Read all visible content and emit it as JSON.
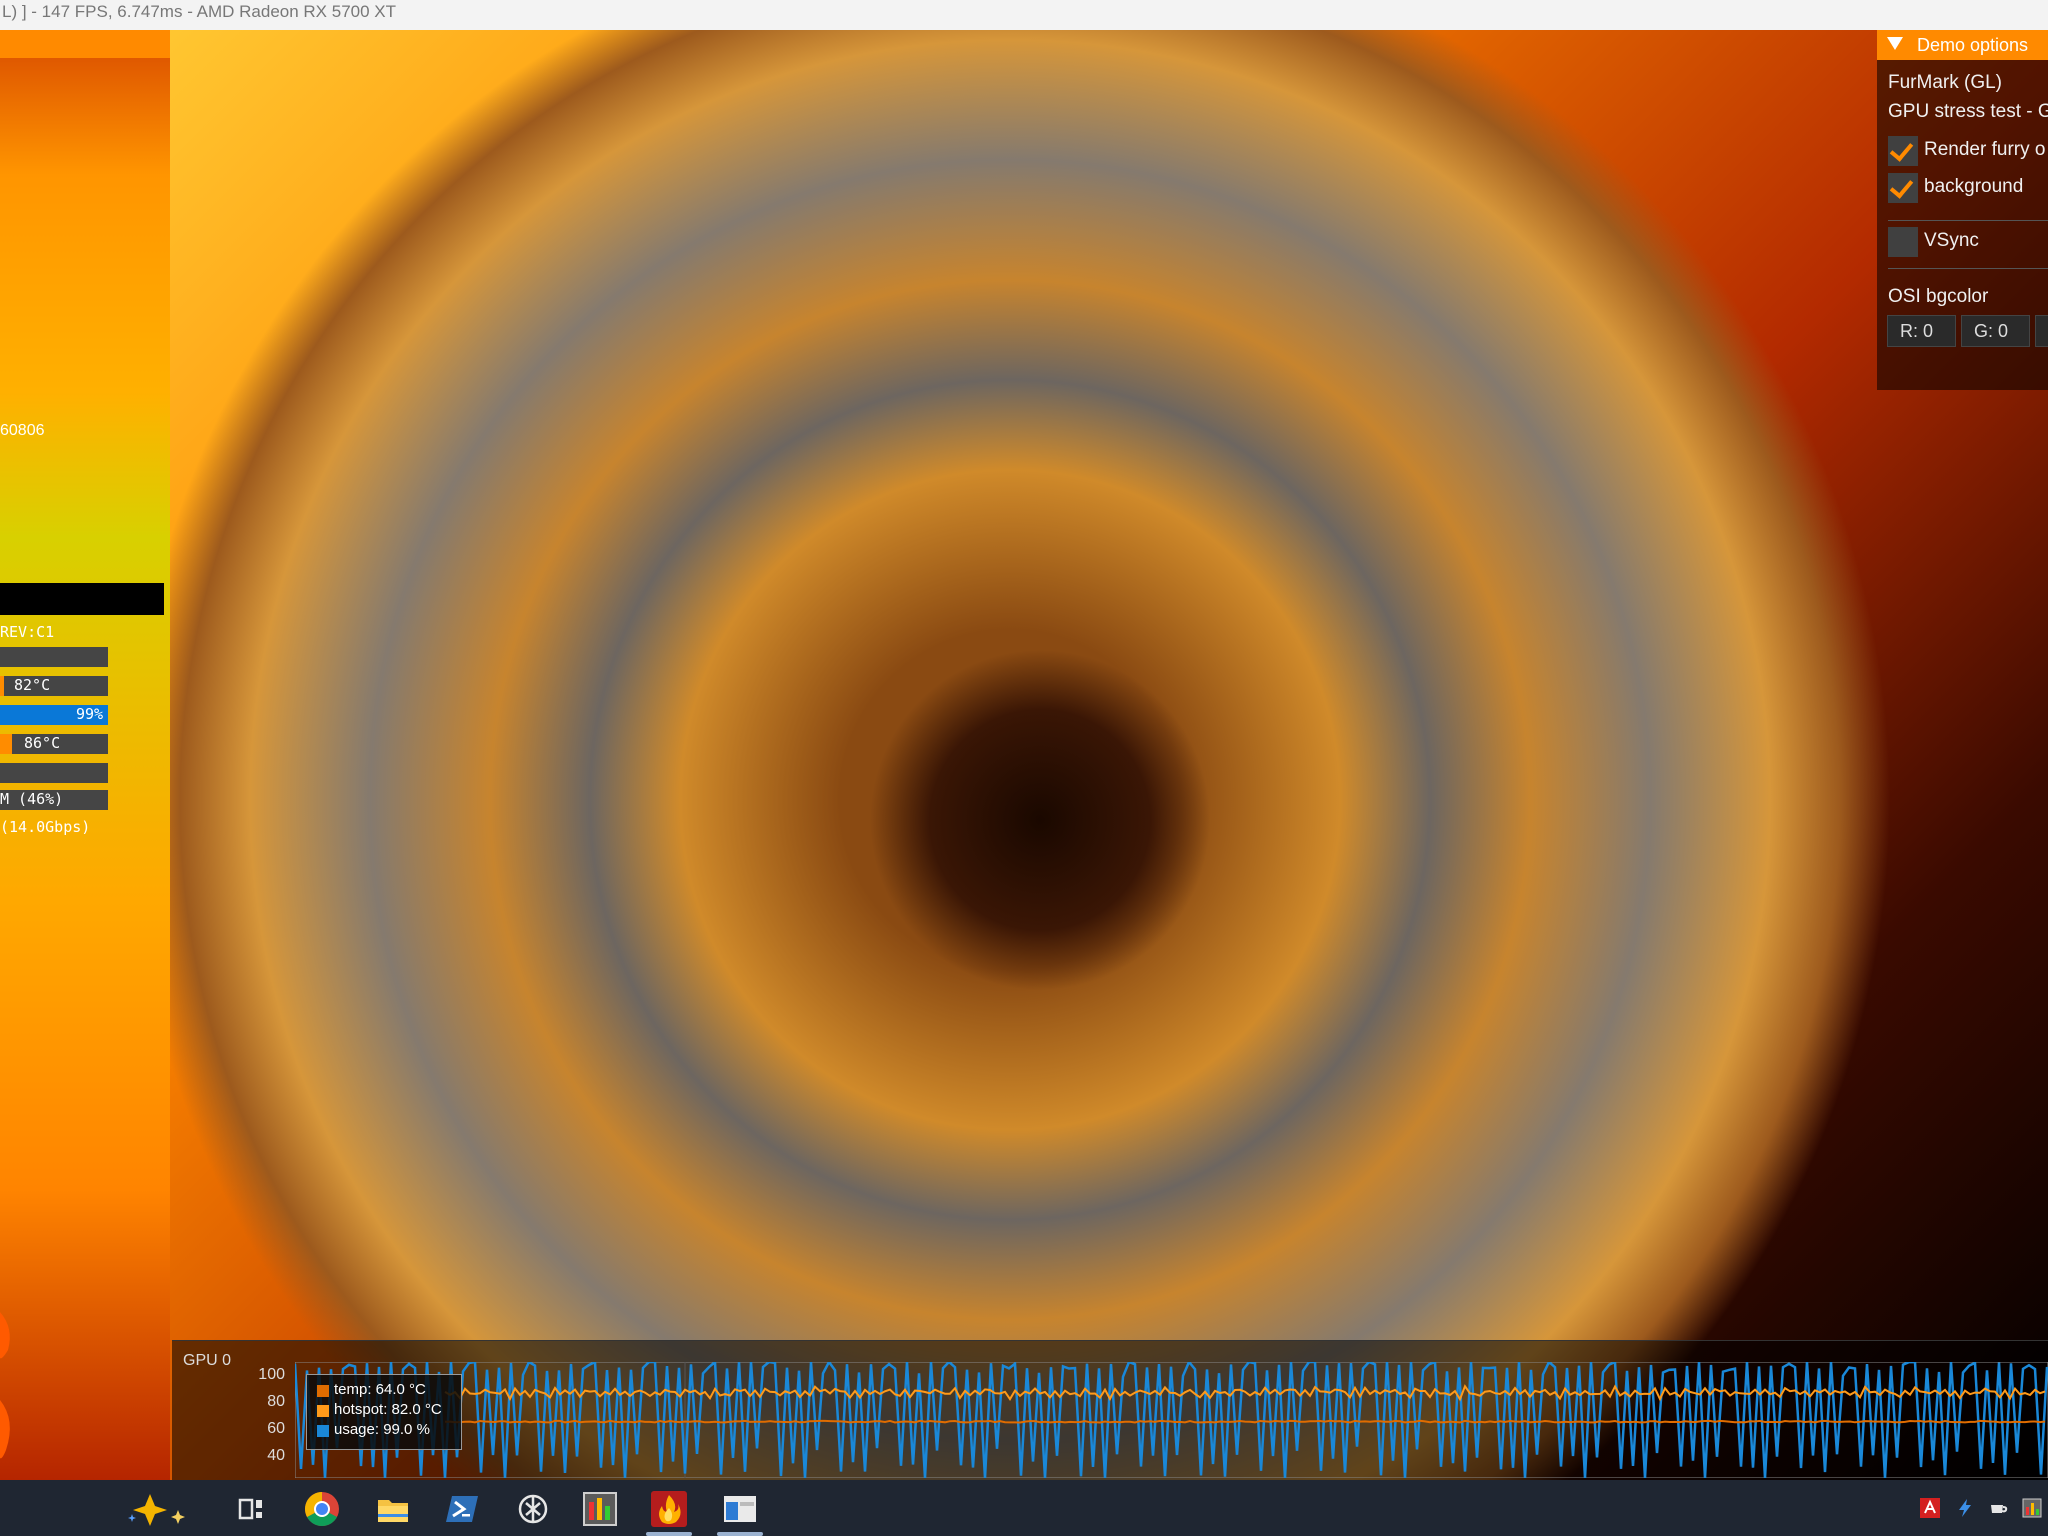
{
  "window": {
    "title": "L) ] - 147 FPS, 6.747ms - AMD Radeon RX 5700 XT"
  },
  "left_panel": {
    "fragment_number": "60806",
    "rev_label": "REV:C1",
    "rows": [
      {
        "label": "82°C",
        "fill_fraction": 0.04,
        "color": "#ff8c00"
      },
      {
        "label": "99%",
        "fill_fraction": 1.0,
        "color": "#0a78d7"
      },
      {
        "label": "86°C",
        "fill_fraction": 0.11,
        "color": "#ff8c00"
      },
      {
        "label": "",
        "fill_fraction": 0.0,
        "color": "#454545"
      },
      {
        "label": "M (46%)",
        "fill_fraction": 0.0,
        "color": "#454545"
      }
    ],
    "memory_speed": "(14.0Gbps)"
  },
  "demo_options": {
    "header": "Demo options",
    "app_name": "FurMark (GL)",
    "mode": "GPU stress test - G",
    "checkbox_render": {
      "label": "Render furry o",
      "checked": true
    },
    "checkbox_background": {
      "label": "background",
      "checked": true
    },
    "checkbox_vsync": {
      "label": "VSync",
      "checked": false
    },
    "osi_label": "OSI bgcolor",
    "color_r": "R: 0",
    "color_g": "G: 0"
  },
  "graph": {
    "title": "GPU 0",
    "y_ticks": [
      "100",
      "80",
      "60",
      "40"
    ],
    "legend": [
      {
        "label": "temp: 64.0 °C",
        "color": "#e06c00"
      },
      {
        "label": "hotspot: 82.0 °C",
        "color": "#ff9a1a"
      },
      {
        "label": "usage: 99.0 %",
        "color": "#1a88d8"
      }
    ]
  },
  "chart_data": {
    "type": "line",
    "title": "GPU 0",
    "ylim": [
      30,
      100
    ],
    "series": [
      {
        "name": "temp: 64.0 °C",
        "values": [
          64,
          64,
          64,
          64,
          64,
          64,
          64,
          64,
          64,
          64
        ]
      },
      {
        "name": "hotspot: 82.0 °C",
        "values": [
          82,
          80,
          83,
          79,
          84,
          81,
          82,
          80,
          83,
          82
        ]
      },
      {
        "name": "usage: 99.0 %",
        "values": [
          99,
          35,
          98,
          40,
          97,
          30,
          99,
          45,
          95,
          99
        ]
      }
    ]
  },
  "taskbar": {
    "apps": [
      "copilot-icon",
      "task-view-icon",
      "chrome-icon",
      "file-explorer-icon",
      "powershell-icon",
      "chatgpt-icon",
      "monitor-app-icon",
      "furmark-icon",
      "window-app-icon"
    ],
    "tray": [
      "amd-icon",
      "bolt-icon",
      "cup-icon",
      "chart-icon"
    ]
  },
  "colors": {
    "accent": "#ff8a00",
    "usage_blue": "#0a78d7",
    "taskbar": "#1f2632"
  }
}
